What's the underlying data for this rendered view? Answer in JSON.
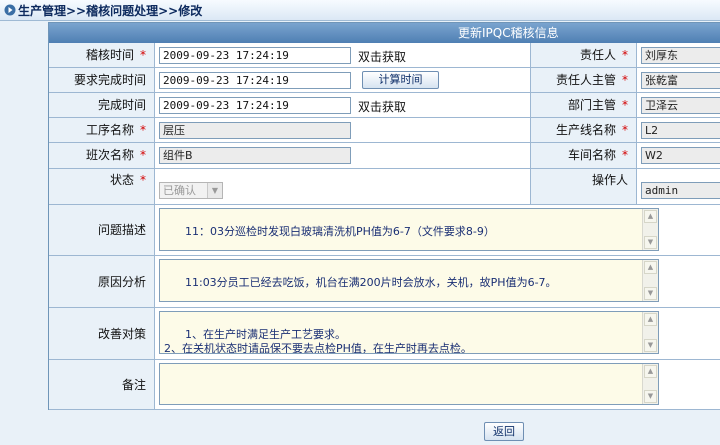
{
  "breadcrumb": "生产管理>>稽核问题处理>>修改",
  "form_title": "更新IPQC稽核信息",
  "fields": {
    "audit_time": {
      "label": "稽核时间",
      "value": "2009-09-23 17:24:19",
      "link": "双击获取"
    },
    "required_completion_time": {
      "label": "要求完成时间",
      "value": "2009-09-23 17:24:19",
      "button": "计算时间"
    },
    "completion_time": {
      "label": "完成时间",
      "value": "2009-09-23 17:24:19",
      "link": "双击获取"
    },
    "process_name": {
      "label": "工序名称",
      "value": "层压"
    },
    "shift_name": {
      "label": "班次名称",
      "value": "组件B"
    },
    "status": {
      "label": "状态",
      "value": "已确认"
    },
    "responsible_person": {
      "label": "责任人",
      "value": "刘厚东"
    },
    "responsible_supervisor": {
      "label": "责任人主管",
      "value": "张乾富"
    },
    "department_supervisor": {
      "label": "部门主管",
      "value": "卫泽云"
    },
    "production_line": {
      "label": "生产线名称",
      "value": "L2"
    },
    "workshop": {
      "label": "车间名称",
      "value": "W2"
    },
    "operator": {
      "label": "操作人",
      "value": "admin"
    },
    "problem_description": {
      "label": "问题描述",
      "value": "11：03分巡检时发现白玻璃清洗机PH值为6-7（文件要求8-9）"
    },
    "root_cause": {
      "label": "原因分析",
      "value": "11:03分员工已经去吃饭，机台在满200片时会放水，关机，故PH值为6-7。"
    },
    "countermeasure": {
      "label": "改善对策",
      "value": "1、在生产时满足生产工艺要求。\n2、在关机状态时请品保不要去点检PH值，在生产时再去点检。"
    },
    "remarks": {
      "label": "备注",
      "value": ""
    }
  },
  "required_mark": "*",
  "back_button": "返回",
  "colors": {
    "header": "#4f7fb3",
    "label_bg": "#e9f1f8",
    "required": "#d40000",
    "textarea_bg": "#fdfbe8"
  }
}
